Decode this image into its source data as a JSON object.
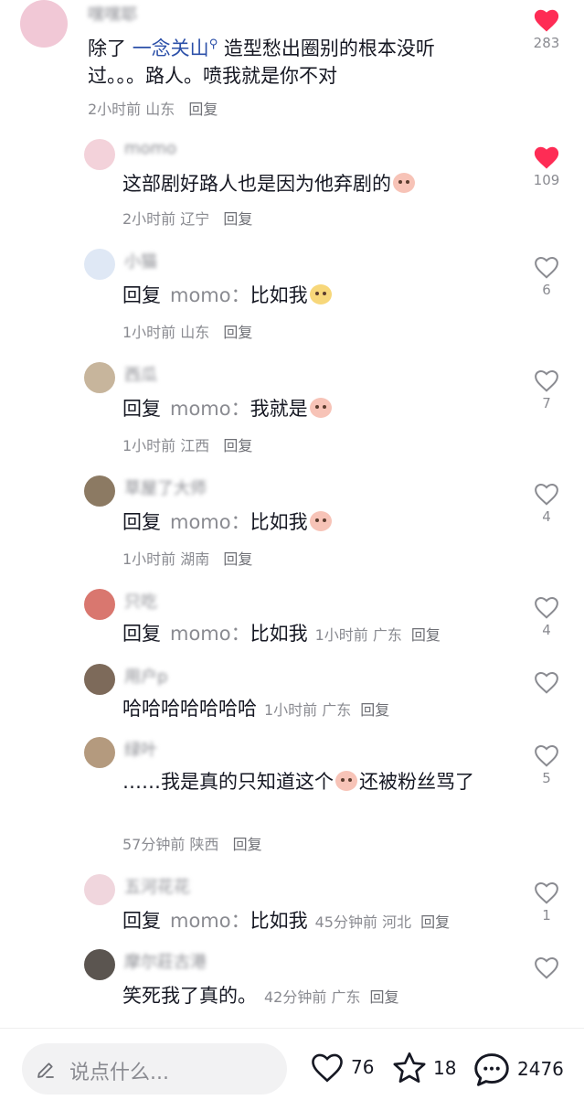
{
  "comments": [
    {
      "username": "嘿嘿耶",
      "text_prefix": "除了 ",
      "mention": "一念关山",
      "text_rest": " 造型愁出圈别的根本没听过。。。路人。喷我就是你不对",
      "time": "2小时前",
      "location": "山东",
      "reply_label": "回复",
      "likes": "283",
      "liked": true
    },
    {
      "username": "momo",
      "text": "这部剧好路人也是因为他弃剧的",
      "time": "2小时前",
      "location": "辽宁",
      "reply_label": "回复",
      "likes": "109",
      "liked": true
    },
    {
      "username": "小猫",
      "reply_prefix": "回复",
      "reply_target": "momo：",
      "text": "比如我",
      "time": "1小时前",
      "location": "山东",
      "reply_label": "回复",
      "likes": "6",
      "liked": false
    },
    {
      "username": "西瓜",
      "reply_prefix": "回复",
      "reply_target": "momo：",
      "text": "我就是",
      "time": "1小时前",
      "location": "江西",
      "reply_label": "回复",
      "likes": "7",
      "liked": false
    },
    {
      "username": "草屋了大师",
      "reply_prefix": "回复",
      "reply_target": "momo：",
      "text": "比如我",
      "time": "1小时前",
      "location": "湖南",
      "reply_label": "回复",
      "likes": "4",
      "liked": false
    },
    {
      "username": "只吃",
      "reply_prefix": "回复",
      "reply_target": "momo：",
      "text": "比如我",
      "time": "1小时前",
      "location": "广东",
      "reply_label": "回复",
      "likes": "4",
      "liked": false
    },
    {
      "username": "用户p",
      "text": "哈哈哈哈哈哈哈",
      "time": "1小时前",
      "location": "广东",
      "reply_label": "回复",
      "likes": "",
      "liked": false
    },
    {
      "username": "绿叶",
      "text_a": "……我是真的只知道这个",
      "text_b": "还被粉丝骂了",
      "time": "57分钟前",
      "location": "陕西",
      "reply_label": "回复",
      "likes": "5",
      "liked": false
    },
    {
      "username": "五河花花",
      "reply_prefix": "回复",
      "reply_target": "momo：",
      "text": "比如我",
      "time": "45分钟前",
      "location": "河北",
      "reply_label": "回复",
      "likes": "1",
      "liked": false
    },
    {
      "username": "摩尔莊古港",
      "text": "笑死我了真的。",
      "time": "42分钟前",
      "location": "广东",
      "reply_label": "回复",
      "likes": "",
      "liked": false
    }
  ],
  "bottom_bar": {
    "placeholder": "说点什么...",
    "like_count": "76",
    "star_count": "18",
    "comment_count": "2476"
  },
  "colors": {
    "liked_heart": "#fe2c55",
    "mention": "#2b4fa8",
    "meta": "#8a8b91"
  }
}
